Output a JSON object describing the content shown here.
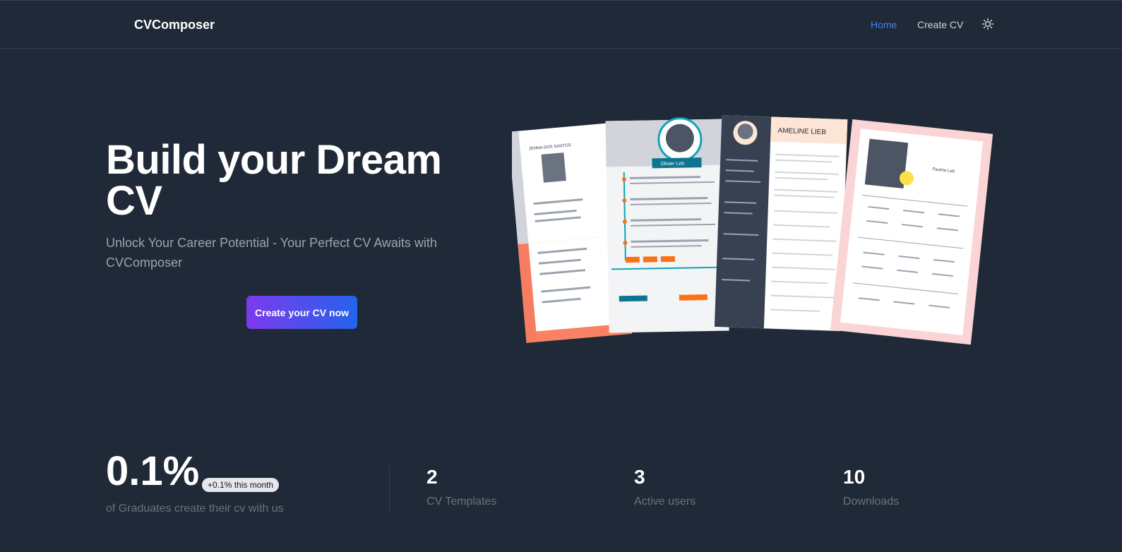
{
  "header": {
    "brand": "CVComposer",
    "nav": {
      "home": "Home",
      "create_cv": "Create CV"
    },
    "theme_icon": "sun-icon"
  },
  "hero": {
    "title": "Build your Dream CV",
    "subtitle": "Unlock Your Career Potential - Your Perfect CV Awaits with CVComposer",
    "cta": "Create your CV now",
    "cv_previews": {
      "card1_name": "JENNA DOS SANTOS",
      "card2_name": "Olivier Leb",
      "card3_name": "AMELINE LIEB",
      "card4_name": "Pauline Leb"
    }
  },
  "stats": {
    "highlight": {
      "value": "0.1%",
      "badge": "+0.1% this month",
      "label": "of Graduates create their cv with us"
    },
    "items": [
      {
        "value": "2",
        "label": "CV Templates"
      },
      {
        "value": "3",
        "label": "Active users"
      },
      {
        "value": "10",
        "label": "Downloads"
      }
    ]
  },
  "colors": {
    "background": "#1f2937",
    "accent": "#3b82f6",
    "cta_start": "#7c3aed",
    "cta_end": "#2563eb"
  }
}
